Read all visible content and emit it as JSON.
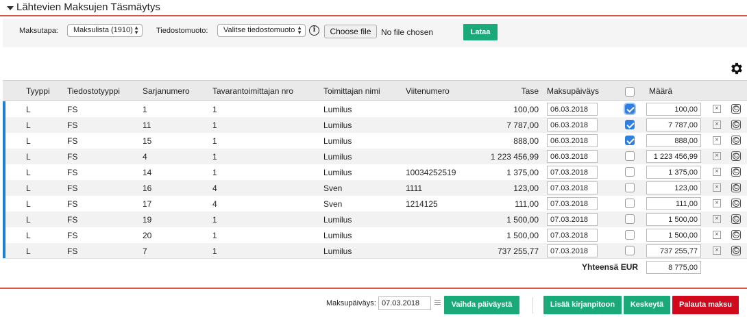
{
  "header": {
    "title": "Lähtevien Maksujen Täsmäytys"
  },
  "filters": {
    "payment_method_label": "Maksutapa:",
    "payment_method_value": "Maksulista (1910)",
    "file_format_label": "Tiedostomuoto:",
    "file_format_value": "Valitse tiedostomuoto",
    "file_button": "Choose file",
    "file_name": "No file chosen",
    "load_button": "Lataa"
  },
  "table": {
    "columns": [
      "Tyyppi",
      "Tiedostotyyppi",
      "Sarjanumero",
      "Tavarantoimittajan nro",
      "Toimittajan nimi",
      "Viitenumero",
      "Tase",
      "Maksupäiväys",
      "Määrä"
    ],
    "rows": [
      {
        "type": "L",
        "file_type": "FS",
        "serial": "1",
        "supplier_no": "1",
        "supplier_name": "Lumilus",
        "reference": "",
        "balance": "100,00",
        "date": "06.03.2018",
        "checked": true,
        "amount": "100,00"
      },
      {
        "type": "L",
        "file_type": "FS",
        "serial": "11",
        "supplier_no": "1",
        "supplier_name": "Lumilus",
        "reference": "",
        "balance": "7 787,00",
        "date": "06.03.2018",
        "checked": true,
        "amount": "7 787,00"
      },
      {
        "type": "L",
        "file_type": "FS",
        "serial": "15",
        "supplier_no": "1",
        "supplier_name": "Lumilus",
        "reference": "",
        "balance": "888,00",
        "date": "06.03.2018",
        "checked": true,
        "amount": "888,00"
      },
      {
        "type": "L",
        "file_type": "FS",
        "serial": "4",
        "supplier_no": "1",
        "supplier_name": "Lumilus",
        "reference": "",
        "balance": "1 223 456,99",
        "date": "06.03.2018",
        "checked": false,
        "amount": "1 223 456,99"
      },
      {
        "type": "L",
        "file_type": "FS",
        "serial": "14",
        "supplier_no": "1",
        "supplier_name": "Lumilus",
        "reference": "10034252519",
        "balance": "1 375,00",
        "date": "07.03.2018",
        "checked": false,
        "amount": "1 375,00"
      },
      {
        "type": "L",
        "file_type": "FS",
        "serial": "16",
        "supplier_no": "4",
        "supplier_name": "Sven",
        "reference": "1111",
        "balance": "123,00",
        "date": "07.03.2018",
        "checked": false,
        "amount": "123,00"
      },
      {
        "type": "L",
        "file_type": "FS",
        "serial": "17",
        "supplier_no": "4",
        "supplier_name": "Sven",
        "reference": "1214125",
        "balance": "111,00",
        "date": "07.03.2018",
        "checked": false,
        "amount": "111,00"
      },
      {
        "type": "L",
        "file_type": "FS",
        "serial": "19",
        "supplier_no": "1",
        "supplier_name": "Lumilus",
        "reference": "",
        "balance": "1 500,00",
        "date": "07.03.2018",
        "checked": false,
        "amount": "1 500,00"
      },
      {
        "type": "L",
        "file_type": "FS",
        "serial": "20",
        "supplier_no": "1",
        "supplier_name": "Lumilus",
        "reference": "",
        "balance": "1 500,00",
        "date": "07.03.2018",
        "checked": false,
        "amount": "1 500,00"
      },
      {
        "type": "L",
        "file_type": "FS",
        "serial": "7",
        "supplier_no": "1",
        "supplier_name": "Lumilus",
        "reference": "",
        "balance": "737 255,77",
        "date": "07.03.2018",
        "checked": false,
        "amount": "737 255,77"
      }
    ],
    "total_label": "Yhteensä EUR",
    "total_value": "8 775,00"
  },
  "footer": {
    "date_label": "Maksupäiväys:",
    "date_value": "07.03.2018",
    "change_date_button": "Vaihda päiväystä",
    "add_to_ledger_button": "Lisää kirjanpitoon",
    "abort_button": "Keskeytä",
    "return_payment_button": "Palauta maksu"
  },
  "colors": {
    "accent_red": "#d9534f",
    "button_green": "#1aaa79",
    "button_red": "#d0091c",
    "row_marker_blue": "#1e7ed0",
    "checkbox_blue": "#2f7fe0"
  }
}
